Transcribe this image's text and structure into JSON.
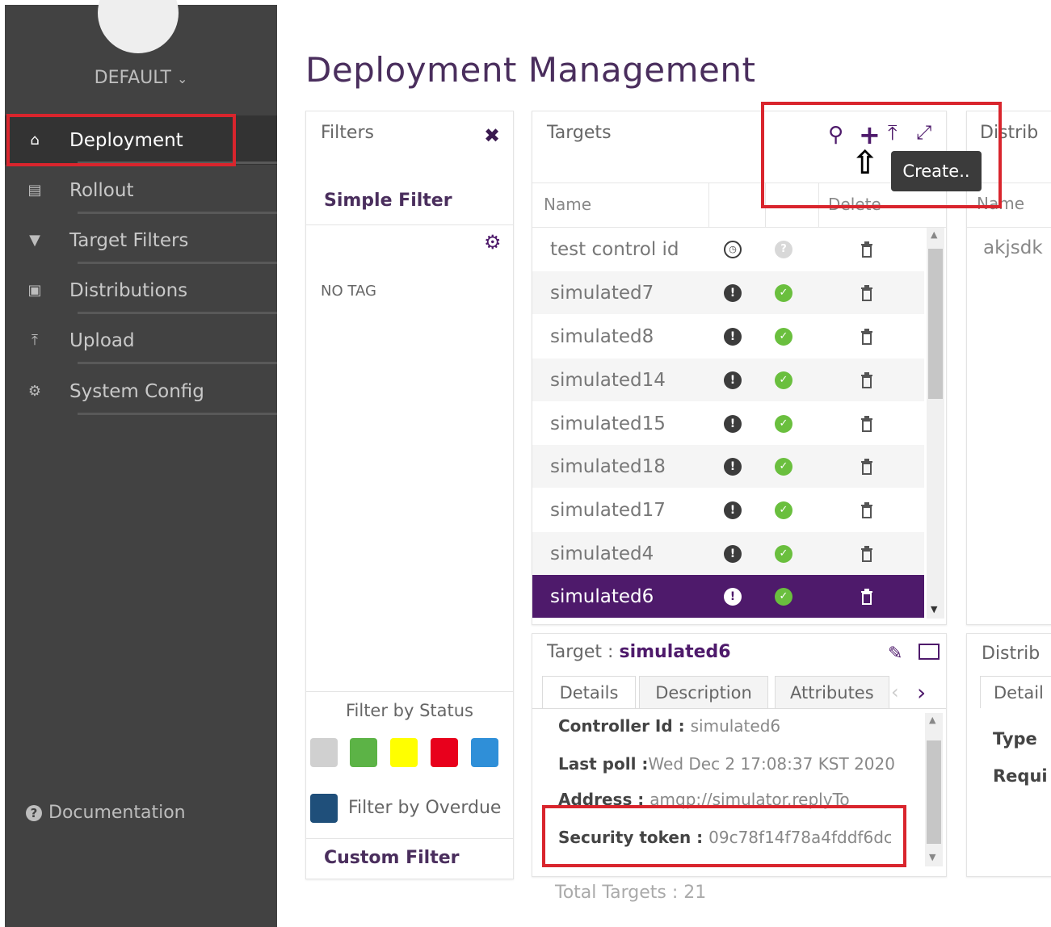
{
  "sidebar": {
    "tenant": "DEFAULT",
    "items": [
      {
        "label": "Deployment",
        "icon": "home-icon",
        "active": true
      },
      {
        "label": "Rollout",
        "icon": "list-icon"
      },
      {
        "label": "Target Filters",
        "icon": "filter-icon"
      },
      {
        "label": "Distributions",
        "icon": "briefcase-icon"
      },
      {
        "label": "Upload",
        "icon": "upload-icon"
      },
      {
        "label": "System Config",
        "icon": "gear-icon"
      }
    ],
    "documentation": "Documentation"
  },
  "page_title": "Deployment Management",
  "filters": {
    "title": "Filters",
    "simple_filter": "Simple Filter",
    "no_tag": "NO TAG",
    "filter_by_status": "Filter by Status",
    "status_colors": [
      "#d0d0d0",
      "#5cb346",
      "#ffff00",
      "#e8001c",
      "#2f8fd8"
    ],
    "overdue_color": "#1f4f7a",
    "filter_by_overdue": "Filter by Overdue",
    "custom_filter": "Custom Filter"
  },
  "targets": {
    "title": "Targets",
    "col_name": "Name",
    "col_delete": "Delete",
    "tooltip": "Create..",
    "rows": [
      {
        "name": "test control id",
        "status": "clock",
        "check": "grey"
      },
      {
        "name": "simulated7",
        "status": "alert",
        "check": "green"
      },
      {
        "name": "simulated8",
        "status": "alert",
        "check": "green"
      },
      {
        "name": "simulated14",
        "status": "alert",
        "check": "green"
      },
      {
        "name": "simulated15",
        "status": "alert",
        "check": "green"
      },
      {
        "name": "simulated18",
        "status": "alert",
        "check": "green"
      },
      {
        "name": "simulated17",
        "status": "alert",
        "check": "green"
      },
      {
        "name": "simulated4",
        "status": "alert",
        "check": "green"
      },
      {
        "name": "simulated6",
        "status": "alert",
        "check": "green",
        "selected": true
      }
    ],
    "total": "Total Targets : 21"
  },
  "detail": {
    "title_prefix": "Target : ",
    "title_name": "simulated6",
    "tabs": [
      "Details",
      "Description",
      "Attributes"
    ],
    "controller_id_label": "Controller Id : ",
    "controller_id": "simulated6",
    "last_poll_label": "Last poll :",
    "last_poll": "Wed Dec 2 17:08:37 KST 2020",
    "address_label": "Address : ",
    "address": "amqp://simulator.replyTo",
    "security_token_label": "Security token : ",
    "security_token": "09c78f14f78a4fddf6dc"
  },
  "distributions": {
    "title": "Distrib",
    "col_name": "Name",
    "first_row": "akjsdk",
    "detail_title": "Distrib",
    "detail_tab": "Detail",
    "type_label": "Type",
    "required_label": "Requi"
  }
}
